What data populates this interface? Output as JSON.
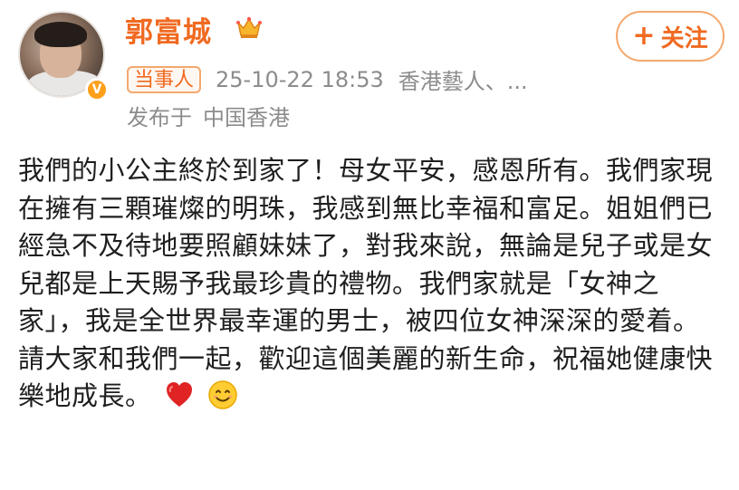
{
  "user": {
    "name": "郭富城",
    "badge": "当事人",
    "timestamp": "25-10-22 18:53",
    "tagline": "香港藝人、...",
    "published_label": "发布于",
    "location": "中国香港",
    "verified_mark": "V"
  },
  "actions": {
    "follow_icon": "+",
    "follow_label": "关注"
  },
  "post": {
    "text": "我們的小公主終於到家了！母女平安，感恩所有。我們家現在擁有三顆璀燦的明珠，我感到無比幸福和富足。姐姐們已經急不及待地要照顧妹妹了，對我來說，無論是兒子或是女兒都是上天賜予我最珍貴的禮物。我們家就是「女神之家」，我是全世界最幸運的男士，被四位女神深深的愛着。請大家和我們一起，歡迎這個美麗的新生命，祝福她健康快樂地成長。"
  },
  "icons": {
    "crown": "crown-icon",
    "verified": "verified-icon",
    "heart": "red-heart-emoji",
    "smile": "smiling-face-emoji"
  },
  "colors": {
    "accent": "#f06a21",
    "muted": "#8c8c8c",
    "verify": "#ff9f1a"
  }
}
